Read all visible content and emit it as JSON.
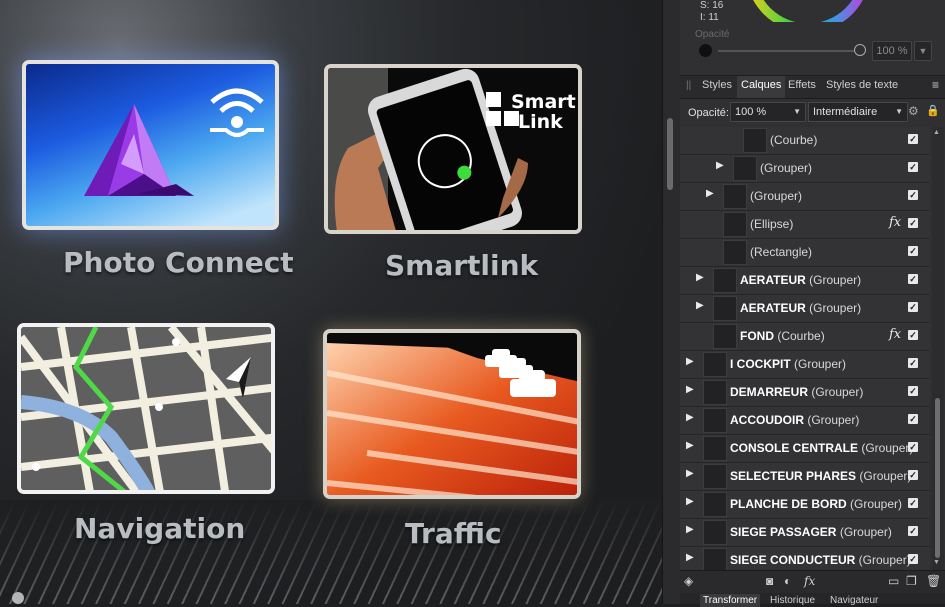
{
  "canvas": {
    "tiles": [
      {
        "label": "Photo  Connect"
      },
      {
        "label": "Smartlink",
        "badge_line1": "Smart",
        "badge_line2": "Link"
      },
      {
        "label": "Navigation"
      },
      {
        "label": "Traffic"
      }
    ]
  },
  "colorinfo": {
    "s": "S: 16",
    "l": "I: 11",
    "opacity_label": "Opacité",
    "opacity_value": "100 %"
  },
  "tabs": [
    "Styles",
    "Calques",
    "Effets",
    "Styles de texte"
  ],
  "active_tab": "Calques",
  "layer_toolbar": {
    "opacity_label": "Opacité:",
    "opacity_value": "100 %",
    "blend_mode": "Intermédiaire"
  },
  "layers": [
    {
      "bold": "",
      "name": "(Courbe)",
      "fx": false,
      "expander": false
    },
    {
      "bold": "",
      "name": "(Grouper)",
      "fx": false,
      "expander": true
    },
    {
      "bold": "",
      "name": "(Grouper)",
      "fx": false,
      "expander": true
    },
    {
      "bold": "",
      "name": "(Ellipse)",
      "fx": true,
      "expander": false
    },
    {
      "bold": "",
      "name": "(Rectangle)",
      "fx": false,
      "expander": false
    },
    {
      "bold": "AERATEUR",
      "name": " (Grouper)",
      "fx": false,
      "expander": true
    },
    {
      "bold": "AERATEUR",
      "name": " (Grouper)",
      "fx": false,
      "expander": true
    },
    {
      "bold": "FOND",
      "name": " (Courbe)",
      "fx": true,
      "expander": false
    },
    {
      "bold": "I COCKPIT",
      "name": " (Grouper)",
      "fx": false,
      "expander": true
    },
    {
      "bold": "DEMARREUR",
      "name": " (Grouper)",
      "fx": false,
      "expander": true
    },
    {
      "bold": "ACCOUDOIR",
      "name": " (Grouper)",
      "fx": false,
      "expander": true
    },
    {
      "bold": "CONSOLE CENTRALE",
      "name": " (Grouper)",
      "fx": false,
      "expander": true
    },
    {
      "bold": "SELECTEUR PHARES",
      "name": " (Grouper)",
      "fx": false,
      "expander": true
    },
    {
      "bold": "PLANCHE DE BORD",
      "name": " (Grouper)",
      "fx": false,
      "expander": true
    },
    {
      "bold": "SIEGE PASSAGER",
      "name": " (Grouper)",
      "fx": false,
      "expander": true
    },
    {
      "bold": "SIEGE CONDUCTEUR",
      "name": " (Grouper)",
      "fx": false,
      "expander": true
    }
  ],
  "bottom_tabs": [
    "Transformer",
    "Historique",
    "Navigateur"
  ],
  "active_bottom_tab": "Transformer",
  "icons": {
    "expand": "▶",
    "check": "✓",
    "fx": "fx",
    "menu": "≡",
    "grip": "||",
    "gear": "⚙"
  },
  "colors": {
    "panel": "#303032",
    "canvas": "#1e1f21",
    "traffic": "#c9240c",
    "photo_accent": "#8b2ad6"
  }
}
